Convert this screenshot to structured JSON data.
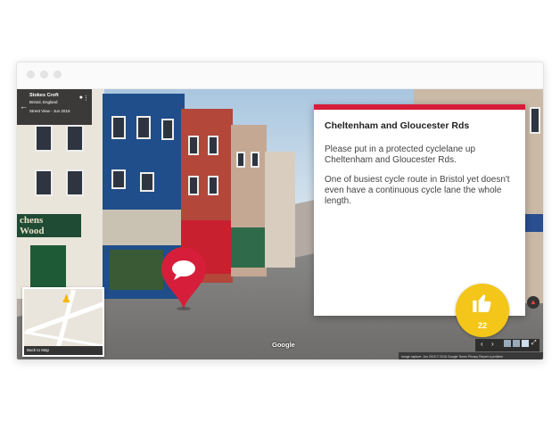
{
  "window": {
    "title_dots": [
      "close",
      "minimize",
      "maximize"
    ]
  },
  "streetview": {
    "place_name": "Stokes Croft",
    "place_region": "Bristol, England",
    "date_label": "Street View - Jun 2015",
    "back_icon": "arrow-left-icon",
    "shop_sign": "chens\nWood",
    "minimap_back_label": "Back to Map",
    "google_watermark": "Google",
    "footer_text": "Image capture: Jun 2015   © 2016 Google   Terms   Privacy   Report a problem"
  },
  "card": {
    "title": "Cheltenham and Gloucester Rds",
    "paragraph_1": "Please put in a protected cyclelane up Cheltenham and Gloucester Rds.",
    "paragraph_2": "One of busiest cycle route in Bristol yet doesn't even have a continuous cycle lane the whole length.",
    "accent_color": "#d61e3a"
  },
  "like": {
    "count": "22",
    "color": "#f3c619"
  },
  "nav": {
    "prev": "‹",
    "next": "›",
    "expand": "⤢"
  }
}
